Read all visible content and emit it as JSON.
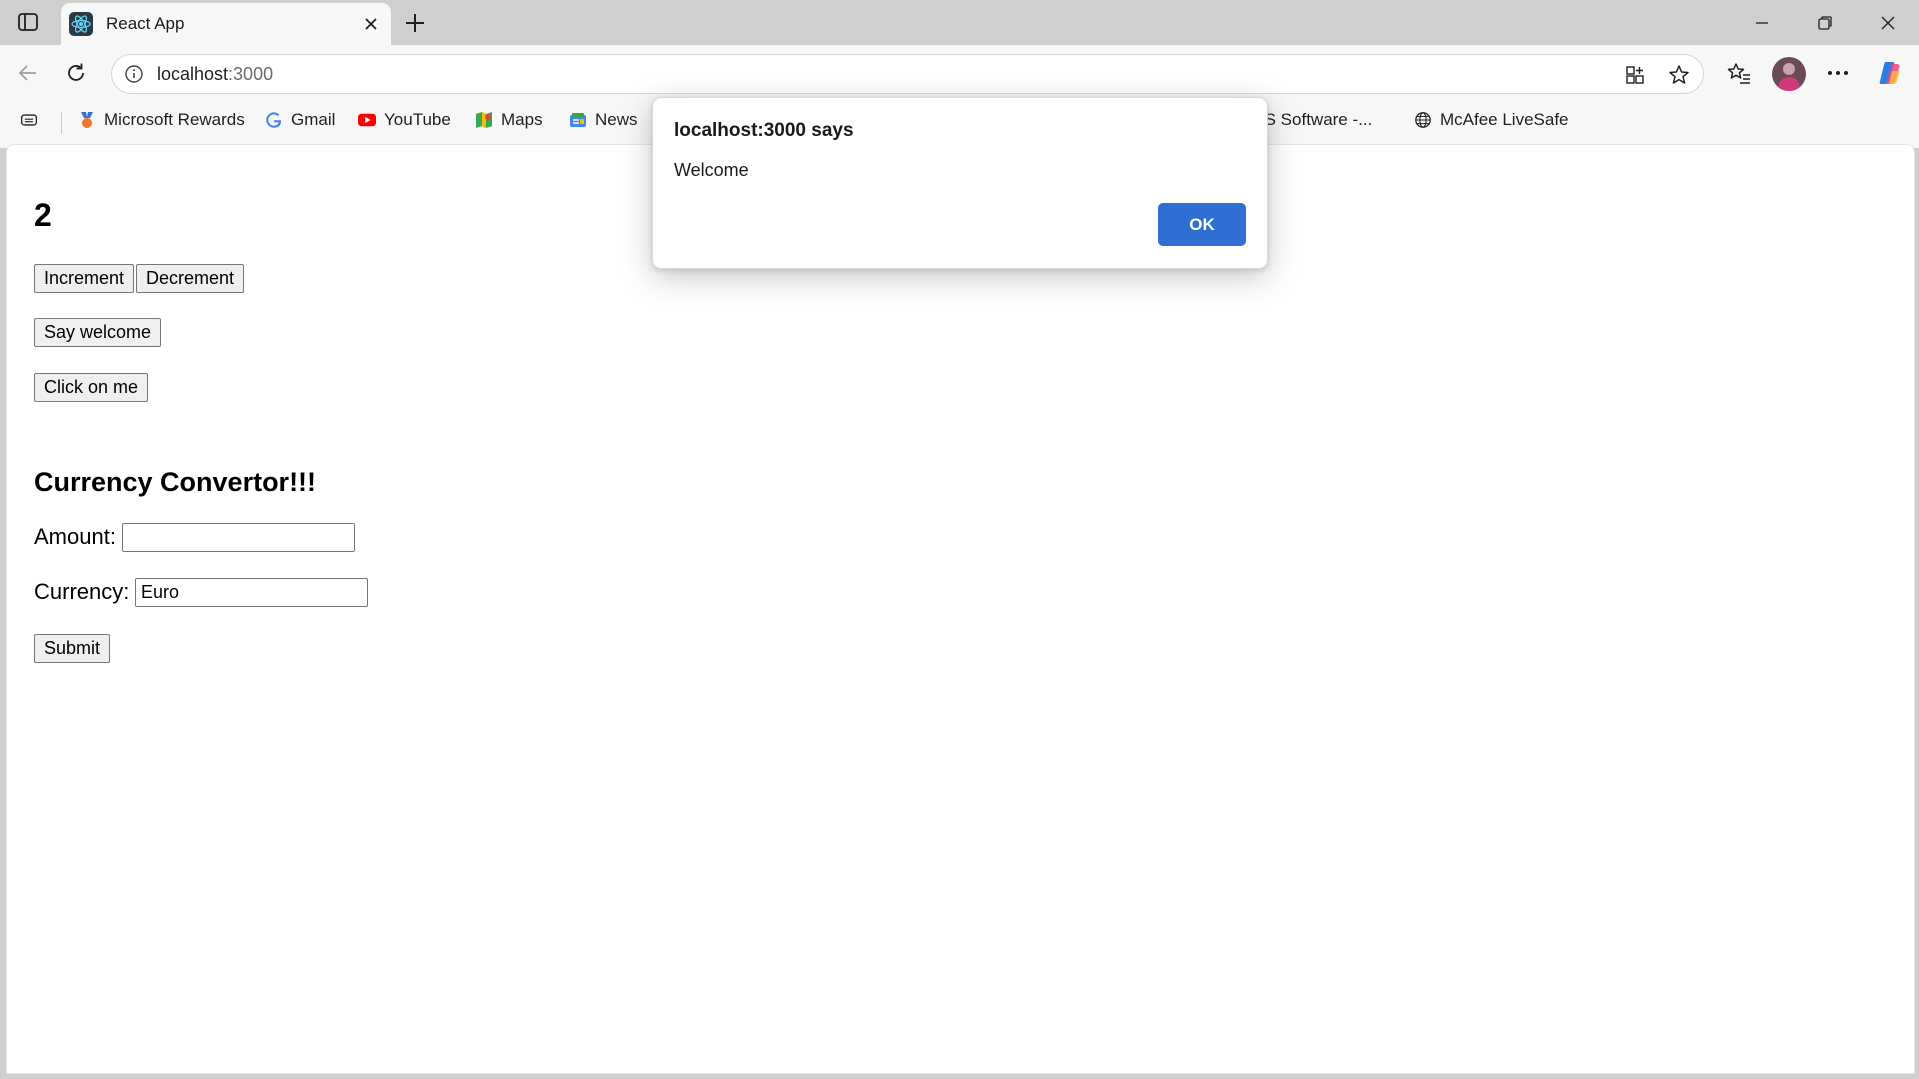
{
  "browser": {
    "tab": {
      "title": "React App",
      "favicon": "react-logo-icon"
    },
    "address": {
      "host": "localhost",
      "port": ":3000"
    },
    "bookmarks": [
      {
        "label": "Microsoft Rewards",
        "icon": "rewards-icon"
      },
      {
        "label": "Gmail",
        "icon": "google-icon"
      },
      {
        "label": "YouTube",
        "icon": "youtube-icon"
      },
      {
        "label": "Maps",
        "icon": "maps-icon"
      },
      {
        "label": "News",
        "icon": "news-icon"
      },
      {
        "label": "SUS Software -...",
        "icon": "folder-icon"
      },
      {
        "label": "McAfee LiveSafe",
        "icon": "globe-icon"
      }
    ],
    "colors": {
      "chrome": "#cfcfcf",
      "toolbar": "#f7f7f7",
      "accent": "#2f6fd3"
    }
  },
  "page": {
    "counter": "2",
    "buttons": {
      "increment": "Increment",
      "decrement": "Decrement",
      "welcome": "Say welcome",
      "click_me": "Click on me"
    },
    "currency": {
      "heading": "Currency Convertor!!!",
      "amount_label": "Amount:",
      "amount_value": "",
      "currency_label": "Currency:",
      "currency_value": "Euro",
      "submit": "Submit"
    }
  },
  "dialog": {
    "title": "localhost:3000 says",
    "message": "Welcome",
    "ok": "OK"
  }
}
